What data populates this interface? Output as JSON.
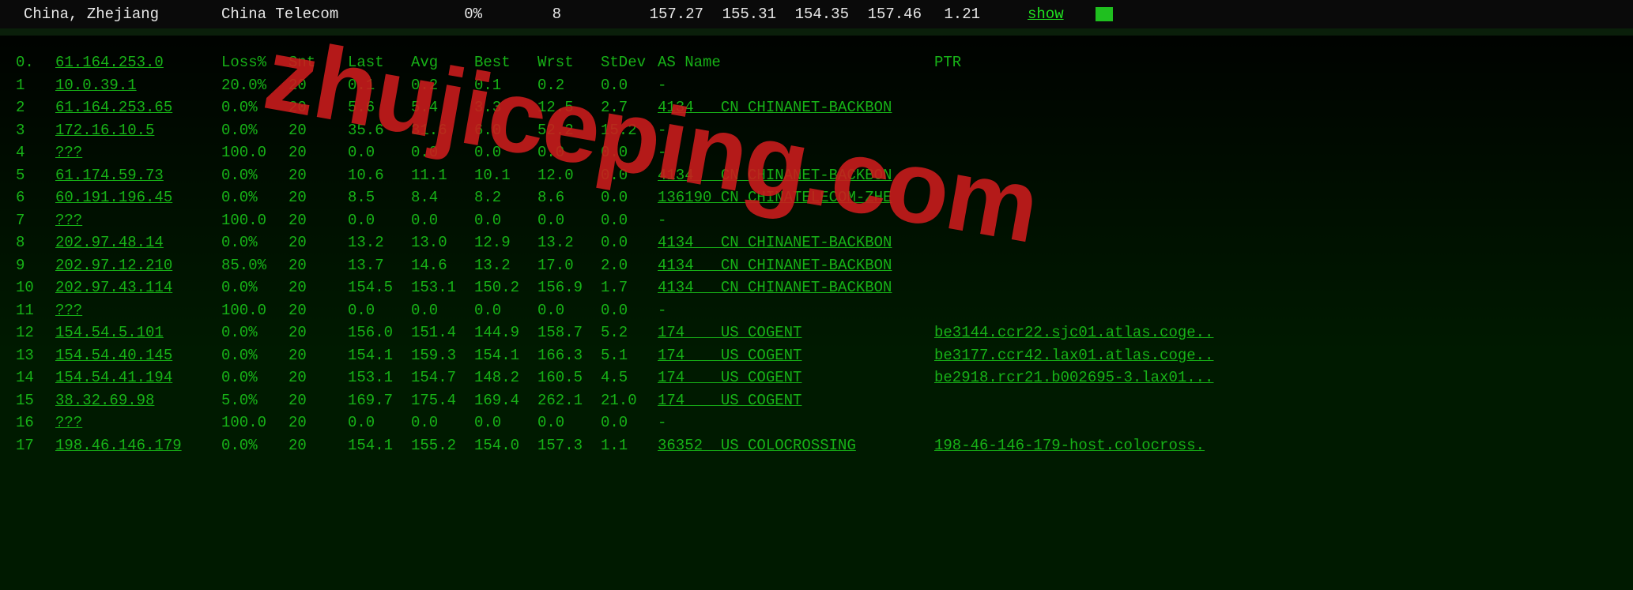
{
  "top": {
    "location": "China, Zhejiang",
    "isp": "China Telecom",
    "loss": "0%",
    "snt": "8",
    "n1": "157.27",
    "n2": "155.31",
    "n3": "154.35",
    "n4": "157.46",
    "std": "1.21",
    "show": "show"
  },
  "headers": {
    "hop": "0.",
    "host": "61.164.253.0",
    "loss": "Loss%",
    "snt": "Snt",
    "last": "Last",
    "avg": "Avg",
    "best": "Best",
    "wrst": "Wrst",
    "std": "StDev",
    "as": "AS Name",
    "ptr": "PTR"
  },
  "rows": [
    {
      "hop": "1",
      "host": "10.0.39.1",
      "loss": "20.0%",
      "snt": "20",
      "last": "0.1",
      "avg": "0.2",
      "best": "0.1",
      "wrst": "0.2",
      "std": "0.0",
      "as": "-",
      "ptr": ""
    },
    {
      "hop": "2",
      "host": "61.164.253.65",
      "loss": "0.0%",
      "snt": "20",
      "last": "5.6",
      "avg": "5.4",
      "best": "3.3",
      "wrst": "12.5",
      "std": "2.7",
      "as": "4134   CN CHINANET-BACKBON",
      "ptr": ""
    },
    {
      "hop": "3",
      "host": "172.16.10.5",
      "loss": "0.0%",
      "snt": "20",
      "last": "35.6",
      "avg": "31.6",
      "best": "6.0",
      "wrst": "52.2",
      "std": "15.2",
      "as": "-",
      "ptr": ""
    },
    {
      "hop": "4",
      "host": "???",
      "loss": "100.0",
      "snt": "20",
      "last": "0.0",
      "avg": "0.0",
      "best": "0.0",
      "wrst": "0.0",
      "std": "0.0",
      "as": "-",
      "ptr": ""
    },
    {
      "hop": "5",
      "host": "61.174.59.73",
      "loss": "0.0%",
      "snt": "20",
      "last": "10.6",
      "avg": "11.1",
      "best": "10.1",
      "wrst": "12.0",
      "std": "0.0",
      "as": "4134   CN CHINANET-BACKBON",
      "ptr": ""
    },
    {
      "hop": "6",
      "host": "60.191.196.45",
      "loss": "0.0%",
      "snt": "20",
      "last": "8.5",
      "avg": "8.4",
      "best": "8.2",
      "wrst": "8.6",
      "std": "0.0",
      "as": "136190 CN CHINATELECOM-ZHE",
      "ptr": ""
    },
    {
      "hop": "7",
      "host": "???",
      "loss": "100.0",
      "snt": "20",
      "last": "0.0",
      "avg": "0.0",
      "best": "0.0",
      "wrst": "0.0",
      "std": "0.0",
      "as": "-",
      "ptr": ""
    },
    {
      "hop": "8",
      "host": "202.97.48.14",
      "loss": "0.0%",
      "snt": "20",
      "last": "13.2",
      "avg": "13.0",
      "best": "12.9",
      "wrst": "13.2",
      "std": "0.0",
      "as": "4134   CN CHINANET-BACKBON",
      "ptr": ""
    },
    {
      "hop": "9",
      "host": "202.97.12.210",
      "loss": "85.0%",
      "snt": "20",
      "last": "13.7",
      "avg": "14.6",
      "best": "13.2",
      "wrst": "17.0",
      "std": "2.0",
      "as": "4134   CN CHINANET-BACKBON",
      "ptr": ""
    },
    {
      "hop": "10",
      "host": "202.97.43.114",
      "loss": "0.0%",
      "snt": "20",
      "last": "154.5",
      "avg": "153.1",
      "best": "150.2",
      "wrst": "156.9",
      "std": "1.7",
      "as": "4134   CN CHINANET-BACKBON",
      "ptr": ""
    },
    {
      "hop": "11",
      "host": "???",
      "loss": "100.0",
      "snt": "20",
      "last": "0.0",
      "avg": "0.0",
      "best": "0.0",
      "wrst": "0.0",
      "std": "0.0",
      "as": "-",
      "ptr": ""
    },
    {
      "hop": "12",
      "host": "154.54.5.101",
      "loss": "0.0%",
      "snt": "20",
      "last": "156.0",
      "avg": "151.4",
      "best": "144.9",
      "wrst": "158.7",
      "std": "5.2",
      "as": "174    US COGENT",
      "ptr": "be3144.ccr22.sjc01.atlas.coge.."
    },
    {
      "hop": "13",
      "host": "154.54.40.145",
      "loss": "0.0%",
      "snt": "20",
      "last": "154.1",
      "avg": "159.3",
      "best": "154.1",
      "wrst": "166.3",
      "std": "5.1",
      "as": "174    US COGENT",
      "ptr": "be3177.ccr42.lax01.atlas.coge.."
    },
    {
      "hop": "14",
      "host": "154.54.41.194",
      "loss": "0.0%",
      "snt": "20",
      "last": "153.1",
      "avg": "154.7",
      "best": "148.2",
      "wrst": "160.5",
      "std": "4.5",
      "as": "174    US COGENT",
      "ptr": "be2918.rcr21.b002695-3.lax01..."
    },
    {
      "hop": "15",
      "host": "38.32.69.98",
      "loss": "5.0%",
      "snt": "20",
      "last": "169.7",
      "avg": "175.4",
      "best": "169.4",
      "wrst": "262.1",
      "std": "21.0",
      "as": "174    US COGENT",
      "ptr": ""
    },
    {
      "hop": "16",
      "host": "???",
      "loss": "100.0",
      "snt": "20",
      "last": "0.0",
      "avg": "0.0",
      "best": "0.0",
      "wrst": "0.0",
      "std": "0.0",
      "as": "-",
      "ptr": ""
    },
    {
      "hop": "17",
      "host": "198.46.146.179",
      "loss": "0.0%",
      "snt": "20",
      "last": "154.1",
      "avg": "155.2",
      "best": "154.0",
      "wrst": "157.3",
      "std": "1.1",
      "as": "36352  US COLOCROSSING",
      "ptr": "198-46-146-179-host.colocross."
    }
  ],
  "watermark": "zhujiceping.com"
}
